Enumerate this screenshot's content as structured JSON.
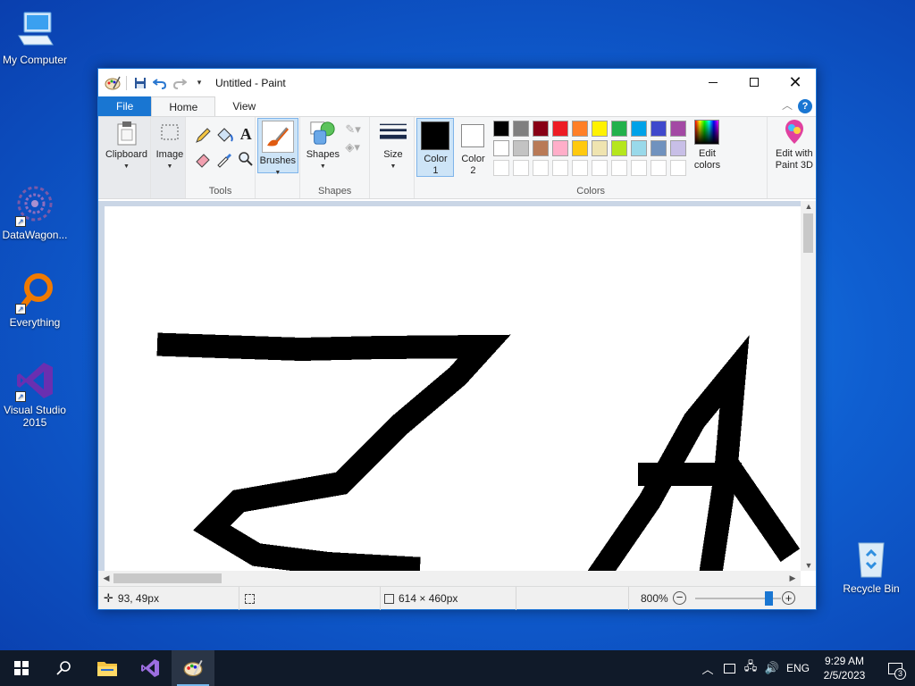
{
  "desktop": {
    "icons": [
      {
        "label": "My Computer"
      },
      {
        "label": "DataWagon..."
      },
      {
        "label": "Everything"
      },
      {
        "label": "Visual Studio 2015"
      },
      {
        "label": "Recycle Bin"
      }
    ]
  },
  "window": {
    "title": "Untitled - Paint",
    "tabs": [
      "File",
      "Home",
      "View"
    ],
    "help_label": "?"
  },
  "ribbon": {
    "clipboard": {
      "label": "Clipboard"
    },
    "image": {
      "label": "Image"
    },
    "tools": {
      "group_label": "Tools"
    },
    "brushes": {
      "label": "Brushes"
    },
    "shapes": {
      "label": "Shapes",
      "group_label": "Shapes"
    },
    "size": {
      "label": "Size"
    },
    "color1": {
      "label_line1": "Color",
      "label_line2": "1"
    },
    "color2": {
      "label_line1": "Color",
      "label_line2": "2"
    },
    "edit_colors": {
      "label_line1": "Edit",
      "label_line2": "colors"
    },
    "paint3d": {
      "label_line1": "Edit with",
      "label_line2": "Paint 3D"
    },
    "colors_group_label": "Colors",
    "palette_row1": [
      "#000000",
      "#7f7f7f",
      "#880015",
      "#ed1c24",
      "#ff7f27",
      "#fff200",
      "#22b14c",
      "#00a2e8",
      "#3f48cc",
      "#a349a4"
    ],
    "palette_row2": [
      "#ffffff",
      "#c3c3c3",
      "#b97a57",
      "#ffaec9",
      "#ffc90e",
      "#efe4b0",
      "#b5e61d",
      "#99d9ea",
      "#7092be",
      "#c8bfe7"
    ],
    "color1_value": "#000000",
    "color2_value": "#ffffff"
  },
  "status": {
    "cursor_pos": "93, 49px",
    "image_size": "614 × 460px",
    "zoom": "800%",
    "zoom_fraction": 0.85
  },
  "taskbar": {
    "time": "9:29 AM",
    "date": "2/5/2023",
    "language": "ENG",
    "notification_count": "3"
  }
}
